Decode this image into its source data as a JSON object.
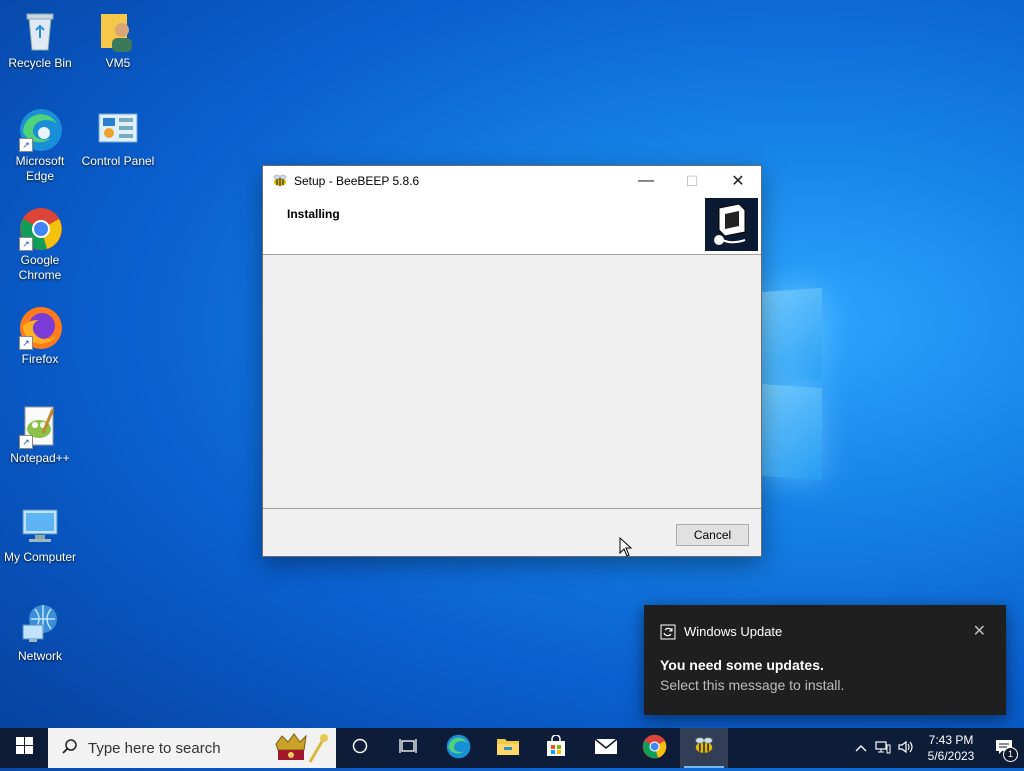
{
  "desktop": {
    "icons": [
      {
        "label": "Recycle Bin",
        "icon": "recycle-bin-icon"
      },
      {
        "label": "VM5",
        "icon": "user-folder-icon"
      },
      {
        "label": "Microsoft Edge",
        "icon": "edge-icon"
      },
      {
        "label": "Control Panel",
        "icon": "control-panel-icon"
      },
      {
        "label": "Google Chrome",
        "icon": "chrome-icon"
      },
      {
        "label": "Firefox",
        "icon": "firefox-icon"
      },
      {
        "label": "Notepad++",
        "icon": "notepadpp-icon"
      },
      {
        "label": "My Computer",
        "icon": "computer-icon"
      },
      {
        "label": "Network",
        "icon": "network-icon"
      }
    ]
  },
  "setup_window": {
    "title": "Setup - BeeBEEP 5.8.6",
    "minimize_glyph": "—",
    "maximize_glyph": "☐",
    "close_glyph": "✕",
    "heading": "Installing",
    "cancel_label": "Cancel"
  },
  "toast": {
    "app_name": "Windows Update",
    "title": "You need some updates.",
    "body": "Select this message to install.",
    "close_glyph": "✕"
  },
  "taskbar": {
    "search_placeholder": "Type here to search",
    "clock_time": "7:43 PM",
    "clock_date": "5/6/2023",
    "notification_count": "1"
  },
  "colors": {
    "desktop_blue": "#0a5fcf",
    "taskbar": "#0e182c",
    "accent": "#76b9ed"
  }
}
